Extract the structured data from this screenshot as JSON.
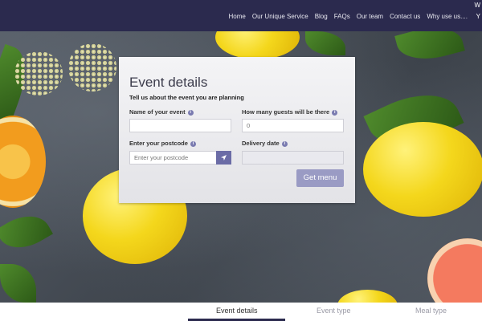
{
  "header": {
    "edge_top": "W",
    "edge_bottom": "Y",
    "nav": [
      "Home",
      "Our Unique Service",
      "Blog",
      "FAQs",
      "Our team",
      "Contact us",
      "Why use us...."
    ]
  },
  "form": {
    "title": "Event details",
    "subtitle": "Tell us about the event you are planning",
    "event_name_label": "Name of your event",
    "event_name_value": "",
    "guests_label": "How many guests will be there",
    "guests_placeholder": "0",
    "postcode_label": "Enter your postcode",
    "postcode_placeholder": "Enter your postcode",
    "delivery_label": "Delivery date",
    "delivery_value": "",
    "submit_label": "Get menu",
    "info_glyph": "i"
  },
  "steps": [
    "Event details",
    "Event type",
    "Meal type"
  ],
  "colors": {
    "nav_bg": "#2b2a4e",
    "accent": "#6b6ca6",
    "button": "#9a9bc4"
  }
}
